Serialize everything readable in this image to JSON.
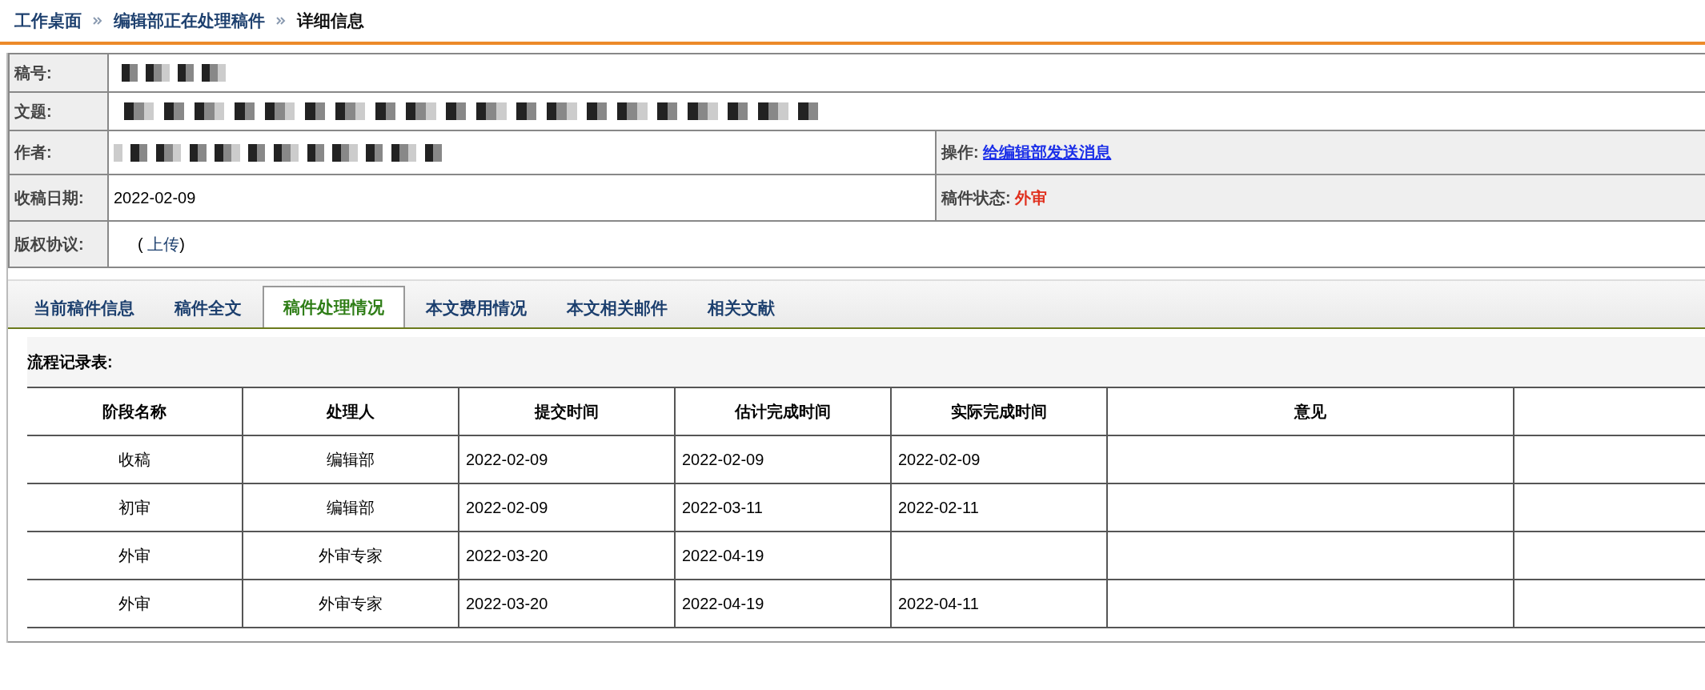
{
  "breadcrumb": [
    {
      "label": "工作桌面",
      "current": false
    },
    {
      "label": "编辑部正在处理稿件",
      "current": false
    },
    {
      "label": "详细信息",
      "current": true
    }
  ],
  "manuscript": {
    "id_label": "稿号:",
    "title_label": "文题:",
    "author_label": "作者:",
    "received": {
      "label": "收稿日期:",
      "value": "2022-02-09"
    },
    "action": {
      "label": "操作:",
      "link": "给编辑部发送消息"
    },
    "status": {
      "label": "稿件状态:",
      "value": "外审"
    },
    "copyright": {
      "label": "版权协议:",
      "open": "(",
      "link": "上传",
      "close": ")"
    }
  },
  "tabs": [
    {
      "label": "当前稿件信息",
      "selected": false
    },
    {
      "label": "稿件全文",
      "selected": false
    },
    {
      "label": "稿件处理情况",
      "selected": true
    },
    {
      "label": "本文费用情况",
      "selected": false
    },
    {
      "label": "本文相关邮件",
      "selected": false
    },
    {
      "label": "相关文献",
      "selected": false
    }
  ],
  "table": {
    "title": "流程记录表:",
    "columns": [
      "阶段名称",
      "处理人",
      "提交时间",
      "估计完成时间",
      "实际完成时间",
      "意见"
    ],
    "rows": [
      {
        "stage": "收稿",
        "handler": "编辑部",
        "submitted": "2022-02-09",
        "estimated": "2022-02-09",
        "actual": "2022-02-09"
      },
      {
        "stage": "初审",
        "handler": "编辑部",
        "submitted": "2022-02-09",
        "estimated": "2022-03-11",
        "actual": "2022-02-11"
      },
      {
        "stage": "外审",
        "handler": "外审专家",
        "submitted": "2022-03-20",
        "estimated": "2022-04-19"
      },
      {
        "stage": "外审",
        "handler": "外审专家",
        "submitted": "2022-03-20",
        "estimated": "2022-04-19",
        "actual": "2022-04-11"
      }
    ]
  }
}
